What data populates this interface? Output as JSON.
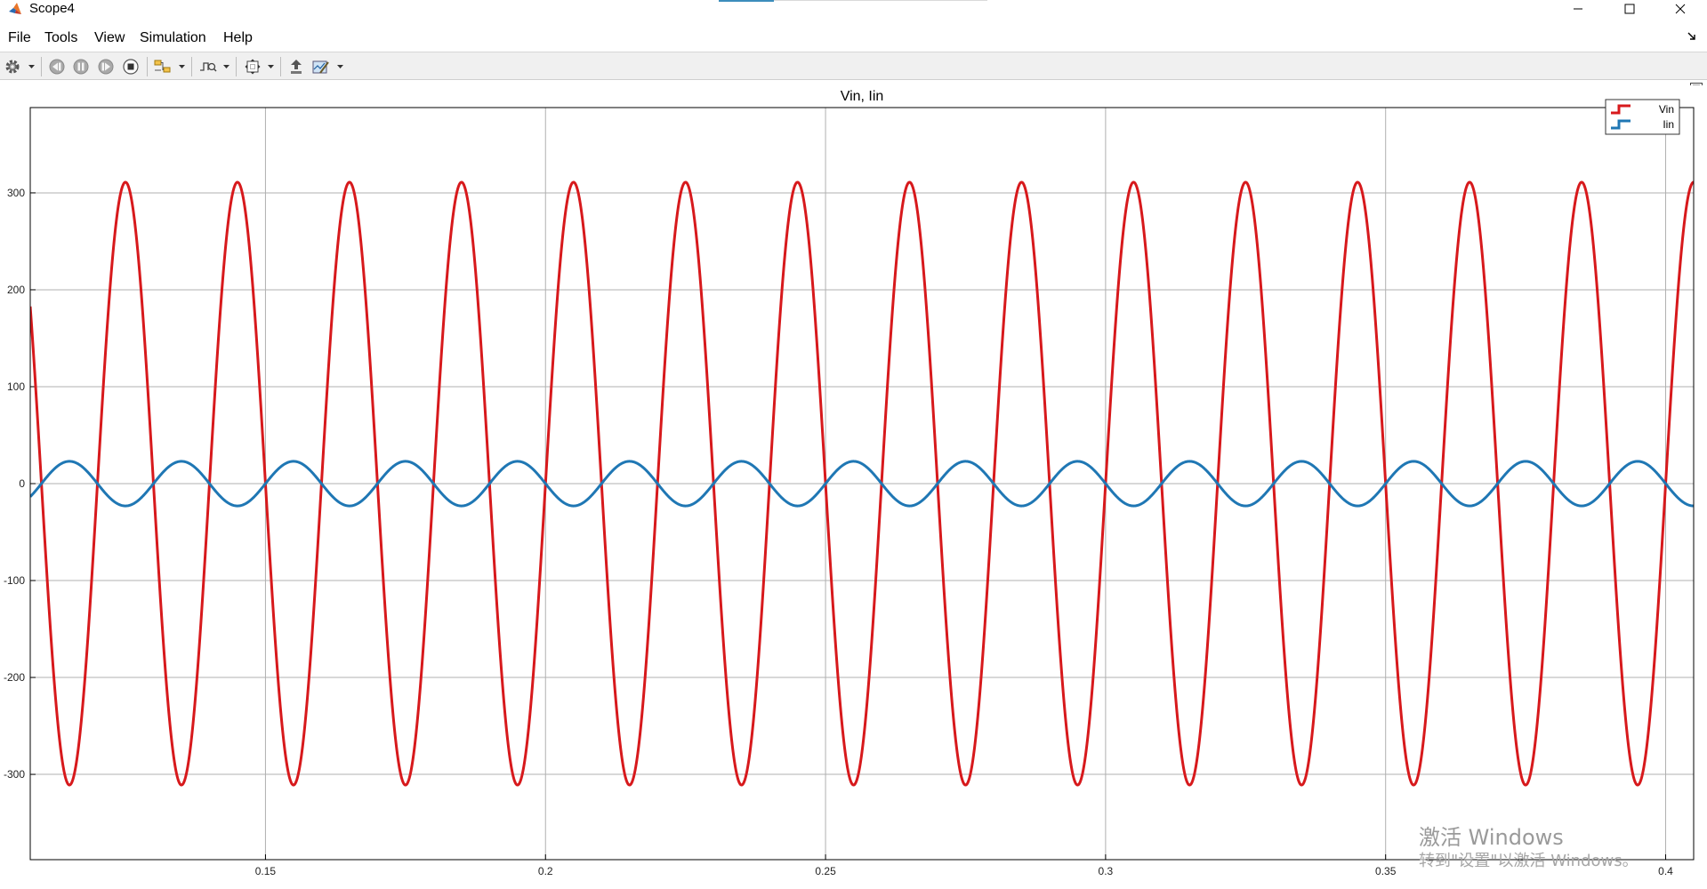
{
  "window": {
    "title": "Scope4",
    "colors": {
      "accent": "#3c8dbc",
      "toolbar_bg": "#f0f0f0"
    }
  },
  "menu": {
    "items": [
      "File",
      "Tools",
      "View",
      "Simulation",
      "Help"
    ]
  },
  "toolbar": {
    "icons": [
      "gear-icon",
      "step-back-icon",
      "pause-icon",
      "step-forward-icon",
      "stop-icon",
      "signal-highlight-icon",
      "trigger-icon",
      "zoom-fit-icon",
      "cursor-measure-icon",
      "edit-style-icon"
    ]
  },
  "watermark": {
    "line1": "激活 Windows",
    "line2": "转到\"设置\"以激活 Windows。"
  },
  "chart_data": {
    "type": "line",
    "title": "Vin, Iin",
    "xlabel": "",
    "ylabel": "",
    "xlim": [
      0.108,
      0.405
    ],
    "ylim": [
      -388,
      388
    ],
    "xticks": [
      0.15,
      0.2,
      0.25,
      0.3,
      0.35,
      0.4
    ],
    "xtick_labels": [
      "0.15",
      "0.2",
      "0.25",
      "0.3",
      "0.35",
      "0.4"
    ],
    "yticks": [
      -300,
      -200,
      -100,
      0,
      100,
      200,
      300
    ],
    "ytick_labels": [
      "-300",
      "-200",
      "-100",
      "0",
      "100",
      "200",
      "300"
    ],
    "grid": true,
    "legend_position": "top-right",
    "series": [
      {
        "name": "Vin",
        "color": "#d7191c",
        "amplitude": 311,
        "frequency_hz": 50,
        "peak_time_s": 0.125,
        "line_width": 3
      },
      {
        "name": "Iin",
        "color": "#1f77b4",
        "amplitude": 23,
        "frequency_hz": 50,
        "peak_time_s": 0.115,
        "line_width": 3
      }
    ]
  }
}
